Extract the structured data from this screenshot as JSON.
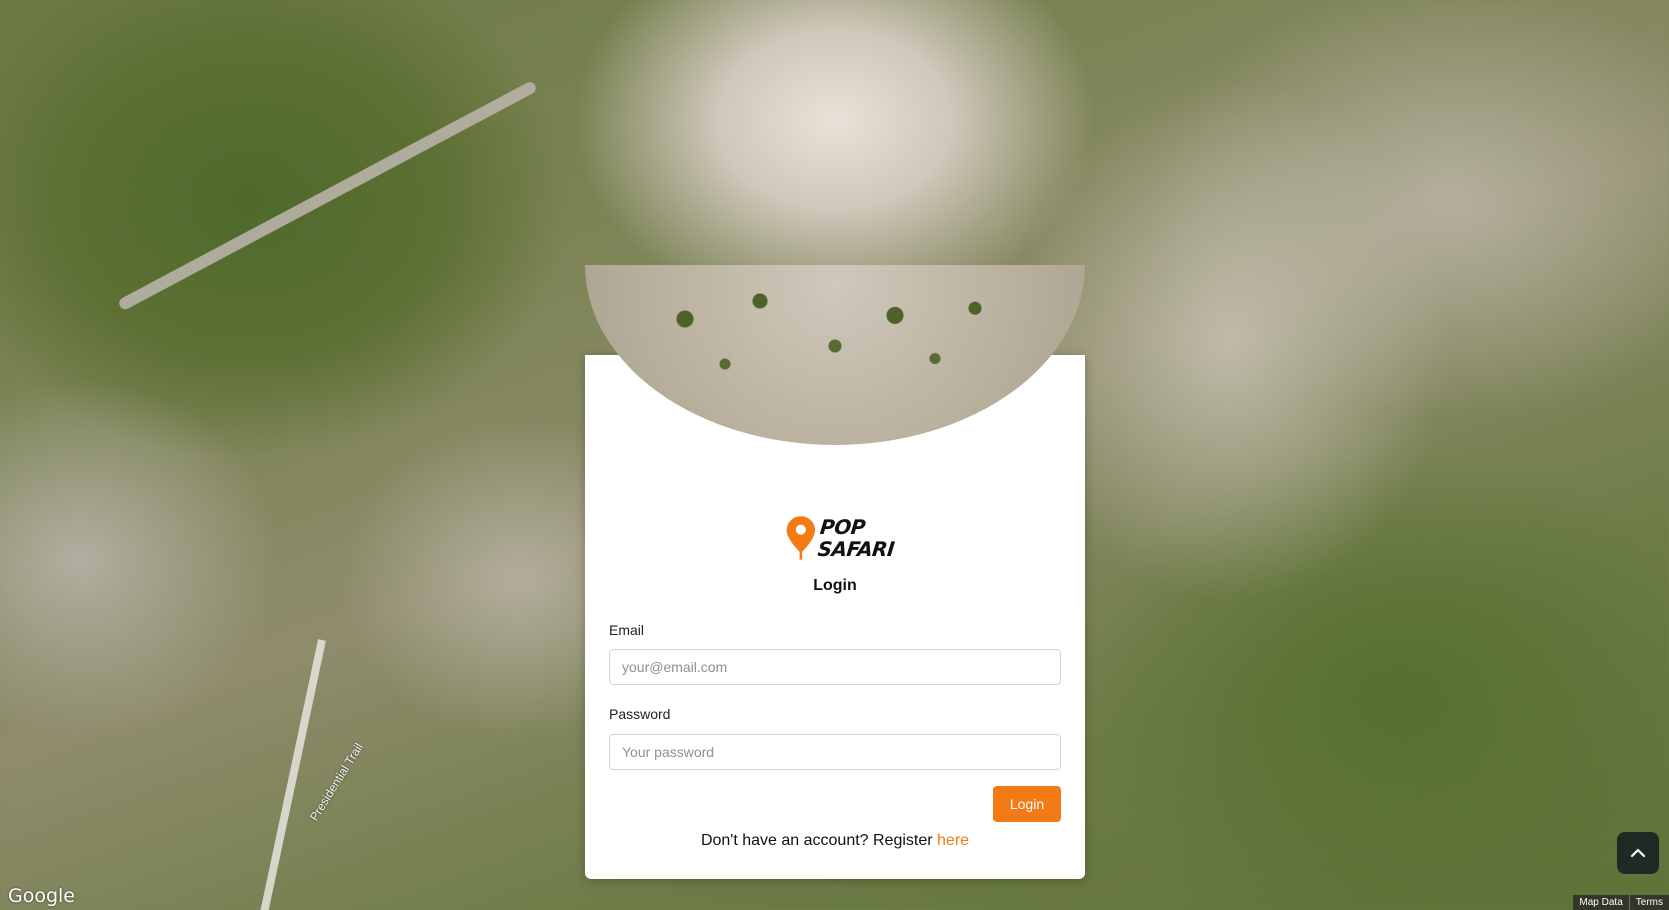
{
  "map": {
    "trail_label": "Presidential Trail",
    "provider_logo": "Google",
    "attribution": [
      "Map Data",
      "Terms"
    ]
  },
  "brand": {
    "logo_line1": "POP",
    "logo_line2": "SAFARI",
    "accent_color": "#f47a16",
    "pin_icon": "map-pin-icon"
  },
  "login": {
    "title": "Login",
    "email_label": "Email",
    "email_placeholder": "your@email.com",
    "email_value": "",
    "password_label": "Password",
    "password_placeholder": "Your password",
    "password_value": "",
    "submit_label": "Login",
    "register_prompt": "Don't have an account? Register ",
    "register_link": "here"
  },
  "controls": {
    "scroll_top_icon": "chevron-up-icon"
  }
}
